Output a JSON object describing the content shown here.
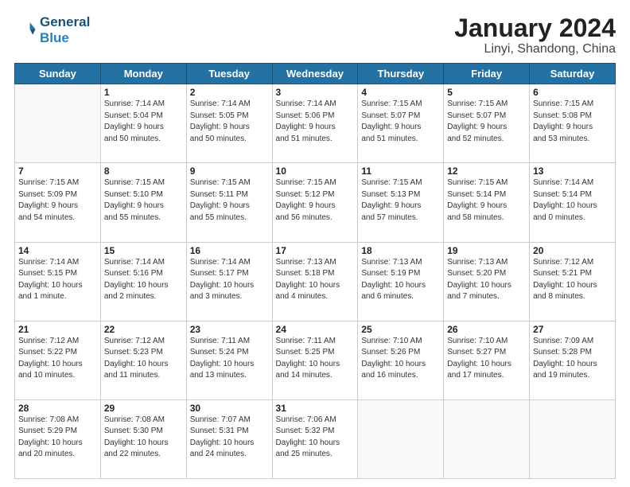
{
  "header": {
    "logo_line1": "General",
    "logo_line2": "Blue",
    "title": "January 2024",
    "subtitle": "Linyi, Shandong, China"
  },
  "days_of_week": [
    "Sunday",
    "Monday",
    "Tuesday",
    "Wednesday",
    "Thursday",
    "Friday",
    "Saturday"
  ],
  "weeks": [
    [
      {
        "day": "",
        "info": ""
      },
      {
        "day": "1",
        "info": "Sunrise: 7:14 AM\nSunset: 5:04 PM\nDaylight: 9 hours\nand 50 minutes."
      },
      {
        "day": "2",
        "info": "Sunrise: 7:14 AM\nSunset: 5:05 PM\nDaylight: 9 hours\nand 50 minutes."
      },
      {
        "day": "3",
        "info": "Sunrise: 7:14 AM\nSunset: 5:06 PM\nDaylight: 9 hours\nand 51 minutes."
      },
      {
        "day": "4",
        "info": "Sunrise: 7:15 AM\nSunset: 5:07 PM\nDaylight: 9 hours\nand 51 minutes."
      },
      {
        "day": "5",
        "info": "Sunrise: 7:15 AM\nSunset: 5:07 PM\nDaylight: 9 hours\nand 52 minutes."
      },
      {
        "day": "6",
        "info": "Sunrise: 7:15 AM\nSunset: 5:08 PM\nDaylight: 9 hours\nand 53 minutes."
      }
    ],
    [
      {
        "day": "7",
        "info": "Sunrise: 7:15 AM\nSunset: 5:09 PM\nDaylight: 9 hours\nand 54 minutes."
      },
      {
        "day": "8",
        "info": "Sunrise: 7:15 AM\nSunset: 5:10 PM\nDaylight: 9 hours\nand 55 minutes."
      },
      {
        "day": "9",
        "info": "Sunrise: 7:15 AM\nSunset: 5:11 PM\nDaylight: 9 hours\nand 55 minutes."
      },
      {
        "day": "10",
        "info": "Sunrise: 7:15 AM\nSunset: 5:12 PM\nDaylight: 9 hours\nand 56 minutes."
      },
      {
        "day": "11",
        "info": "Sunrise: 7:15 AM\nSunset: 5:13 PM\nDaylight: 9 hours\nand 57 minutes."
      },
      {
        "day": "12",
        "info": "Sunrise: 7:15 AM\nSunset: 5:14 PM\nDaylight: 9 hours\nand 58 minutes."
      },
      {
        "day": "13",
        "info": "Sunrise: 7:14 AM\nSunset: 5:14 PM\nDaylight: 10 hours\nand 0 minutes."
      }
    ],
    [
      {
        "day": "14",
        "info": "Sunrise: 7:14 AM\nSunset: 5:15 PM\nDaylight: 10 hours\nand 1 minute."
      },
      {
        "day": "15",
        "info": "Sunrise: 7:14 AM\nSunset: 5:16 PM\nDaylight: 10 hours\nand 2 minutes."
      },
      {
        "day": "16",
        "info": "Sunrise: 7:14 AM\nSunset: 5:17 PM\nDaylight: 10 hours\nand 3 minutes."
      },
      {
        "day": "17",
        "info": "Sunrise: 7:13 AM\nSunset: 5:18 PM\nDaylight: 10 hours\nand 4 minutes."
      },
      {
        "day": "18",
        "info": "Sunrise: 7:13 AM\nSunset: 5:19 PM\nDaylight: 10 hours\nand 6 minutes."
      },
      {
        "day": "19",
        "info": "Sunrise: 7:13 AM\nSunset: 5:20 PM\nDaylight: 10 hours\nand 7 minutes."
      },
      {
        "day": "20",
        "info": "Sunrise: 7:12 AM\nSunset: 5:21 PM\nDaylight: 10 hours\nand 8 minutes."
      }
    ],
    [
      {
        "day": "21",
        "info": "Sunrise: 7:12 AM\nSunset: 5:22 PM\nDaylight: 10 hours\nand 10 minutes."
      },
      {
        "day": "22",
        "info": "Sunrise: 7:12 AM\nSunset: 5:23 PM\nDaylight: 10 hours\nand 11 minutes."
      },
      {
        "day": "23",
        "info": "Sunrise: 7:11 AM\nSunset: 5:24 PM\nDaylight: 10 hours\nand 13 minutes."
      },
      {
        "day": "24",
        "info": "Sunrise: 7:11 AM\nSunset: 5:25 PM\nDaylight: 10 hours\nand 14 minutes."
      },
      {
        "day": "25",
        "info": "Sunrise: 7:10 AM\nSunset: 5:26 PM\nDaylight: 10 hours\nand 16 minutes."
      },
      {
        "day": "26",
        "info": "Sunrise: 7:10 AM\nSunset: 5:27 PM\nDaylight: 10 hours\nand 17 minutes."
      },
      {
        "day": "27",
        "info": "Sunrise: 7:09 AM\nSunset: 5:28 PM\nDaylight: 10 hours\nand 19 minutes."
      }
    ],
    [
      {
        "day": "28",
        "info": "Sunrise: 7:08 AM\nSunset: 5:29 PM\nDaylight: 10 hours\nand 20 minutes."
      },
      {
        "day": "29",
        "info": "Sunrise: 7:08 AM\nSunset: 5:30 PM\nDaylight: 10 hours\nand 22 minutes."
      },
      {
        "day": "30",
        "info": "Sunrise: 7:07 AM\nSunset: 5:31 PM\nDaylight: 10 hours\nand 24 minutes."
      },
      {
        "day": "31",
        "info": "Sunrise: 7:06 AM\nSunset: 5:32 PM\nDaylight: 10 hours\nand 25 minutes."
      },
      {
        "day": "",
        "info": ""
      },
      {
        "day": "",
        "info": ""
      },
      {
        "day": "",
        "info": ""
      }
    ]
  ]
}
